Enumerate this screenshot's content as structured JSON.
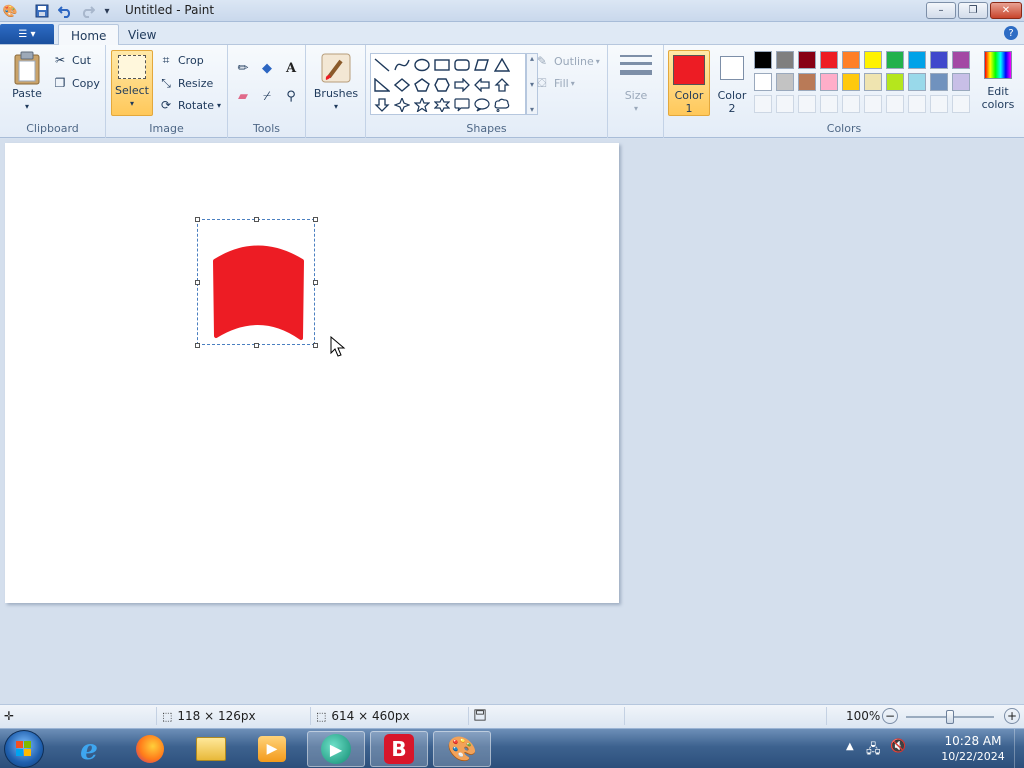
{
  "window": {
    "title": "Untitled - Paint",
    "minimize_glyph": "–",
    "restore_glyph": "❐",
    "close_glyph": "✕"
  },
  "menu": {
    "app_button_glyph": "☰ ▾",
    "tabs": [
      {
        "label": "Home",
        "active": true
      },
      {
        "label": "View",
        "active": false
      }
    ],
    "help_glyph": "?"
  },
  "ribbon": {
    "clipboard": {
      "label": "Clipboard",
      "paste": "Paste",
      "cut": "Cut",
      "copy": "Copy"
    },
    "image": {
      "label": "Image",
      "select": "Select",
      "crop": "Crop",
      "resize": "Resize",
      "rotate": "Rotate"
    },
    "tools": {
      "label": "Tools",
      "items": [
        "pencil-icon",
        "fill-icon",
        "text-icon",
        "eraser-icon",
        "color-picker-icon",
        "magnifier-icon"
      ]
    },
    "brushes": {
      "label": "Brushes"
    },
    "shapes": {
      "label": "Shapes",
      "outline": "Outline",
      "fill": "Fill"
    },
    "size": {
      "label": "Size"
    },
    "colors": {
      "label": "Colors",
      "color1_line1": "Color",
      "color1_line2": "1",
      "color2_line1": "Color",
      "color2_line2": "2",
      "edit_line1": "Edit",
      "edit_line2": "colors",
      "color1_value": "#ed1c24",
      "color2_value": "#ffffff",
      "palette_row1": [
        "#000000",
        "#7f7f7f",
        "#880015",
        "#ed1c24",
        "#ff7f27",
        "#fff200",
        "#22b14c",
        "#00a2e8",
        "#3f48cc",
        "#a349a4"
      ],
      "palette_row2": [
        "#ffffff",
        "#c3c3c3",
        "#b97a57",
        "#ffaec9",
        "#ffc90e",
        "#efe4b0",
        "#b5e61d",
        "#99d9ea",
        "#7092be",
        "#c8bfe7"
      ]
    }
  },
  "canvas": {
    "shape_color": "#ed1c24"
  },
  "status": {
    "selection_size": "118 × 126px",
    "canvas_size": "614 × 460px",
    "zoom": "100%"
  },
  "taskbar": {
    "time": "10:28 AM",
    "date": "10/22/2024"
  }
}
